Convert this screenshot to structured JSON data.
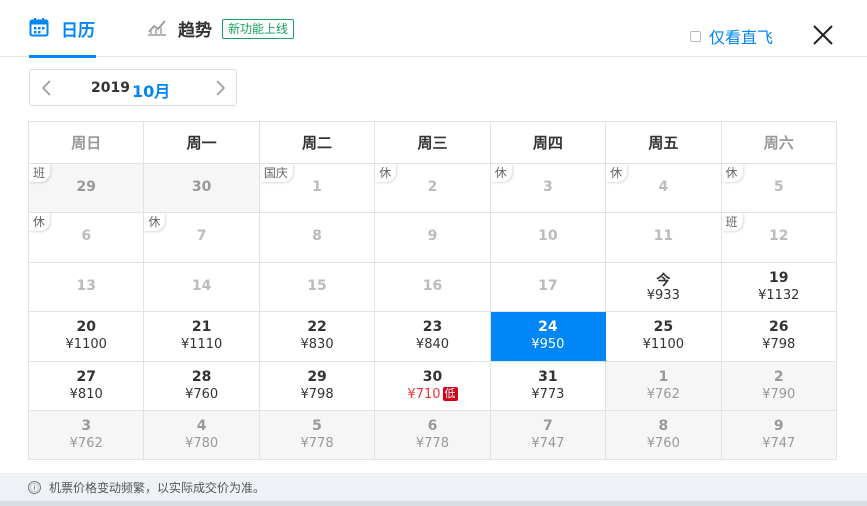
{
  "header": {
    "tab_calendar": "日历",
    "tab_trend": "趋势",
    "badge_new": "新功能上线",
    "direct_only": "仅看直飞",
    "colors": {
      "accent": "#0086f6",
      "badge": "#19a15f"
    }
  },
  "month_picker": {
    "year": "2019",
    "month": "10月"
  },
  "weekdays": [
    "周日",
    "周一",
    "周二",
    "周三",
    "周四",
    "周五",
    "周六"
  ],
  "weeks": [
    [
      {
        "day": "29",
        "price": "",
        "tag": "班",
        "grey": true
      },
      {
        "day": "30",
        "price": "",
        "tag": "",
        "grey": true
      },
      {
        "day": "1",
        "price": "",
        "tag": "国庆"
      },
      {
        "day": "2",
        "price": "",
        "tag": "休"
      },
      {
        "day": "3",
        "price": "",
        "tag": "休"
      },
      {
        "day": "4",
        "price": "",
        "tag": "休"
      },
      {
        "day": "5",
        "price": "",
        "tag": "休"
      }
    ],
    [
      {
        "day": "6",
        "price": "",
        "tag": "休"
      },
      {
        "day": "7",
        "price": "",
        "tag": "休"
      },
      {
        "day": "8",
        "price": "",
        "tag": ""
      },
      {
        "day": "9",
        "price": "",
        "tag": ""
      },
      {
        "day": "10",
        "price": "",
        "tag": ""
      },
      {
        "day": "11",
        "price": "",
        "tag": ""
      },
      {
        "day": "12",
        "price": "",
        "tag": "班"
      }
    ],
    [
      {
        "day": "13",
        "price": "",
        "tag": ""
      },
      {
        "day": "14",
        "price": "",
        "tag": ""
      },
      {
        "day": "15",
        "price": "",
        "tag": ""
      },
      {
        "day": "16",
        "price": "",
        "tag": ""
      },
      {
        "day": "17",
        "price": "",
        "tag": ""
      },
      {
        "day": "今",
        "price": "¥933",
        "tag": ""
      },
      {
        "day": "19",
        "price": "¥1132",
        "tag": ""
      }
    ],
    [
      {
        "day": "20",
        "price": "¥1100",
        "tag": ""
      },
      {
        "day": "21",
        "price": "¥1110",
        "tag": ""
      },
      {
        "day": "22",
        "price": "¥830",
        "tag": ""
      },
      {
        "day": "23",
        "price": "¥840",
        "tag": ""
      },
      {
        "day": "24",
        "price": "¥950",
        "tag": "",
        "selected": true
      },
      {
        "day": "25",
        "price": "¥1100",
        "tag": ""
      },
      {
        "day": "26",
        "price": "¥798",
        "tag": ""
      }
    ],
    [
      {
        "day": "27",
        "price": "¥810",
        "tag": ""
      },
      {
        "day": "28",
        "price": "¥760",
        "tag": ""
      },
      {
        "day": "29",
        "price": "¥798",
        "tag": ""
      },
      {
        "day": "30",
        "price": "¥710",
        "tag": "",
        "low": true,
        "low_label": "低"
      },
      {
        "day": "31",
        "price": "¥773",
        "tag": ""
      },
      {
        "day": "1",
        "price": "¥762",
        "tag": "",
        "grey": true
      },
      {
        "day": "2",
        "price": "¥790",
        "tag": "",
        "grey": true
      }
    ],
    [
      {
        "day": "3",
        "price": "¥762",
        "tag": "",
        "grey": true
      },
      {
        "day": "4",
        "price": "¥780",
        "tag": "",
        "grey": true
      },
      {
        "day": "5",
        "price": "¥778",
        "tag": "",
        "grey": true
      },
      {
        "day": "6",
        "price": "¥778",
        "tag": "",
        "grey": true
      },
      {
        "day": "7",
        "price": "¥747",
        "tag": "",
        "grey": true
      },
      {
        "day": "8",
        "price": "¥760",
        "tag": "",
        "grey": true
      },
      {
        "day": "9",
        "price": "¥747",
        "tag": "",
        "grey": true
      }
    ]
  ],
  "footer": {
    "notice": "机票价格变动频繁，以实际成交价为准。",
    "info_icon": "ⓘ"
  },
  "icons": {
    "calendar": "calendar-icon",
    "trend": "trend-chart-icon",
    "close": "close-icon",
    "prev": "chevron-left-icon",
    "next": "chevron-right-icon"
  }
}
